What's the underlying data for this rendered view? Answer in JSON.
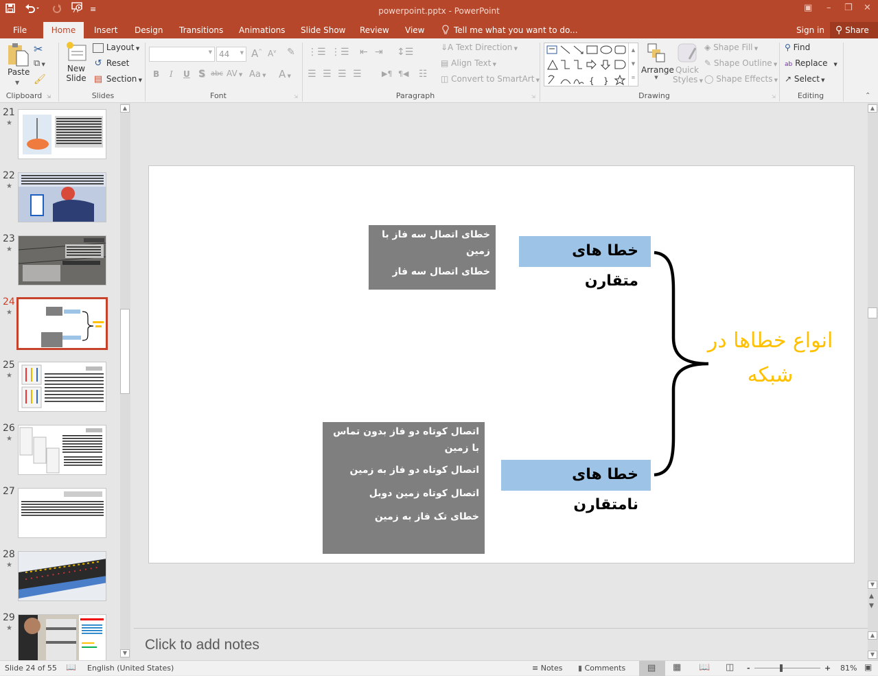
{
  "window": {
    "title": "powerpoint.pptx - PowerPoint",
    "controls": [
      "ribbon-display-options",
      "minimize",
      "restore",
      "close"
    ]
  },
  "qat": {
    "save": "save-icon",
    "undo": "undo-icon",
    "redo": "redo-icon",
    "present": "start-from-beginning-icon",
    "customize": "customize-qat-icon"
  },
  "tabs": [
    {
      "label": "File",
      "active": false
    },
    {
      "label": "Home",
      "active": true
    },
    {
      "label": "Insert",
      "active": false
    },
    {
      "label": "Design",
      "active": false
    },
    {
      "label": "Transitions",
      "active": false
    },
    {
      "label": "Animations",
      "active": false
    },
    {
      "label": "Slide Show",
      "active": false
    },
    {
      "label": "Review",
      "active": false
    },
    {
      "label": "View",
      "active": false
    }
  ],
  "tell_me": "Tell me what you want to do...",
  "sign_in": "Sign in",
  "share": "Share",
  "ribbon": {
    "clipboard": {
      "label": "Clipboard",
      "paste": "Paste"
    },
    "slides": {
      "label": "Slides",
      "new_slide_1": "New",
      "new_slide_2": "Slide",
      "layout": "Layout",
      "reset": "Reset",
      "section": "Section"
    },
    "font": {
      "label": "Font",
      "font_name": "",
      "font_size": "44",
      "bold": "B",
      "italic": "I",
      "underline": "U",
      "shadow": "S",
      "strike": "abc",
      "spacing": "AV",
      "case": "Aa",
      "color": "A"
    },
    "paragraph": {
      "label": "Paragraph",
      "text_direction": "Text Direction",
      "align_text": "Align Text",
      "convert_smartart": "Convert to SmartArt"
    },
    "drawing": {
      "label": "Drawing",
      "arrange": "Arrange",
      "quick_styles_1": "Quick",
      "quick_styles_2": "Styles",
      "shape_fill": "Shape Fill",
      "shape_outline": "Shape Outline",
      "shape_effects": "Shape Effects"
    },
    "editing": {
      "label": "Editing",
      "find": "Find",
      "replace": "Replace",
      "select": "Select"
    }
  },
  "thumbnails": [
    {
      "number": "21",
      "starred": true,
      "selected": false
    },
    {
      "number": "22",
      "starred": true,
      "selected": false
    },
    {
      "number": "23",
      "starred": true,
      "selected": false
    },
    {
      "number": "24",
      "starred": true,
      "selected": true
    },
    {
      "number": "25",
      "starred": true,
      "selected": false
    },
    {
      "number": "26",
      "starred": true,
      "selected": false
    },
    {
      "number": "27",
      "starred": false,
      "selected": false
    },
    {
      "number": "28",
      "starred": true,
      "selected": false
    },
    {
      "number": "29",
      "starred": true,
      "selected": false
    }
  ],
  "slide": {
    "title": "انواع خطاها در شبکه",
    "title_color": "#ffc000",
    "symmetric": {
      "label": "خطا های متقارن",
      "items": [
        "خطای اتصال سه فاز با زمین",
        "خطای اتصال سه فاز"
      ]
    },
    "asymmetric": {
      "label": "خطا های نامتقارن",
      "items": [
        "اتصال کوتاه دو فاز بدون تماس با زمین",
        "اتصال کوتاه دو فاز به زمین",
        "اتصال کوتاه زمین دوبل",
        "خطای تک فاز به زمین"
      ]
    },
    "box_color": "#7f7f7f",
    "label_color": "#9dc3e6"
  },
  "notes_placeholder": "Click to add notes",
  "status": {
    "slide_info": "Slide 24 of 55",
    "language": "English (United States)",
    "notes": "Notes",
    "comments": "Comments",
    "zoom_level": "81%",
    "zoom_minus": "-",
    "zoom_plus": "+"
  }
}
